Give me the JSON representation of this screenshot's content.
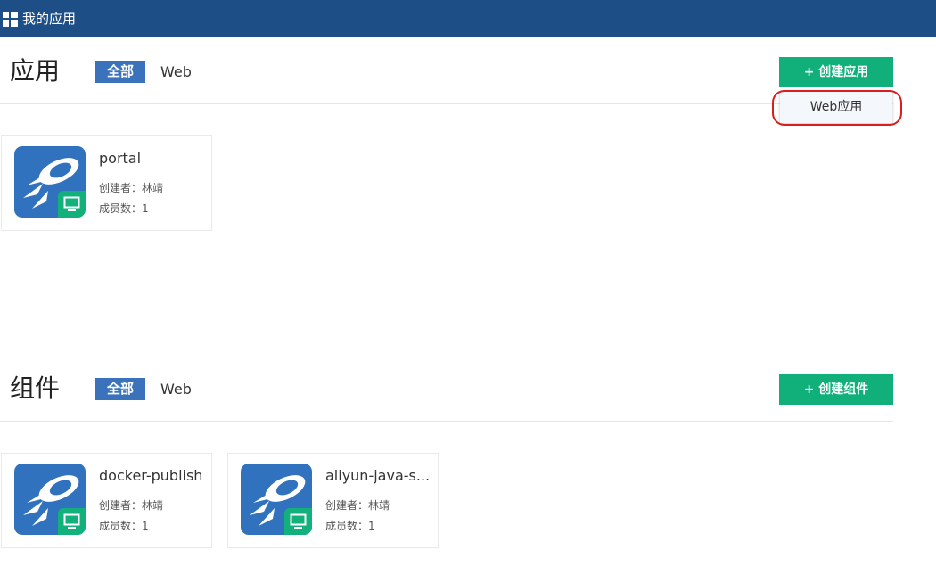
{
  "header": {
    "title": "我的应用",
    "icon": "grid-icon"
  },
  "apps": {
    "title": "应用",
    "tabs": {
      "active": "全部",
      "other": "Web"
    },
    "create_button": "+ 创建应用",
    "dropdown": {
      "items": [
        "Web应用"
      ]
    },
    "cards": [
      {
        "name": "portal",
        "creator": "创建者：林靖",
        "members": "成员数：1"
      }
    ]
  },
  "components": {
    "title": "组件",
    "tabs": {
      "active": "全部",
      "other": "Web"
    },
    "create_button": "+ 创建组件",
    "cards": [
      {
        "name": "docker-publish",
        "creator": "创建者：林靖",
        "members": "成员数：1"
      },
      {
        "name": "aliyun-java-s...",
        "creator": "创建者：林靖",
        "members": "成员数：1"
      }
    ]
  },
  "colors": {
    "header": "#1d4f86",
    "tab_active": "#3a73bb",
    "create_button": "#11b07a",
    "logo": "#3172be",
    "highlight": "#d81e1e"
  }
}
